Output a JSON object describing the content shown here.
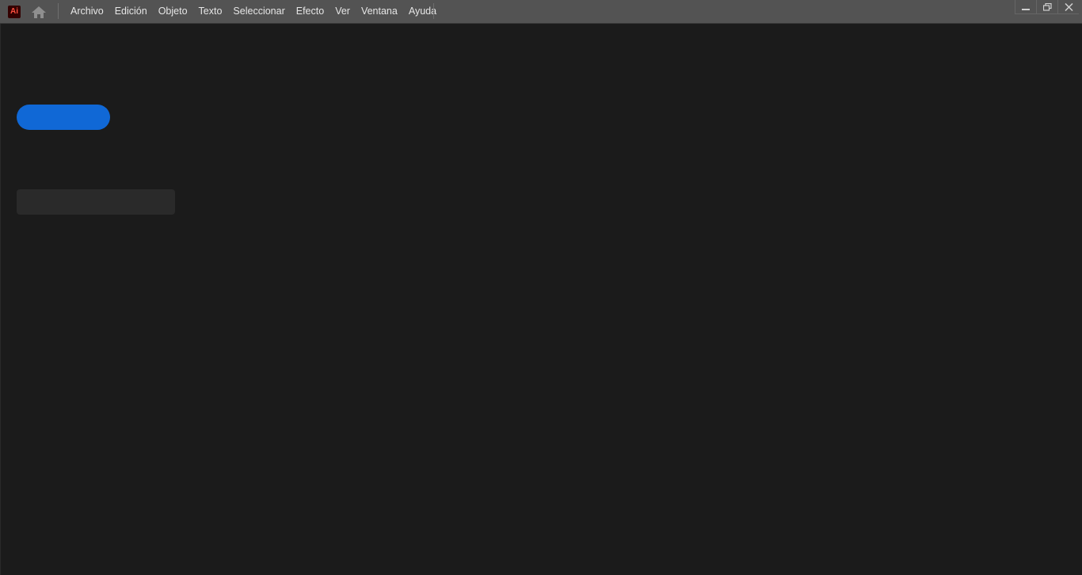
{
  "app": {
    "logo_text": "Ai",
    "accent": "#1068d6"
  },
  "menu": [
    {
      "label": "Archivo"
    },
    {
      "label": "Edición"
    },
    {
      "label": "Objeto"
    },
    {
      "label": "Texto"
    },
    {
      "label": "Seleccionar"
    },
    {
      "label": "Efecto"
    },
    {
      "label": "Ver"
    },
    {
      "label": "Ventana"
    },
    {
      "label": "Ayuda"
    }
  ],
  "icons": {
    "home": "home-icon",
    "minimize": "minimize-icon",
    "restore": "restore-icon",
    "close": "close-icon"
  },
  "home_screen": {
    "primary_button_label": "",
    "secondary_block_label": ""
  }
}
